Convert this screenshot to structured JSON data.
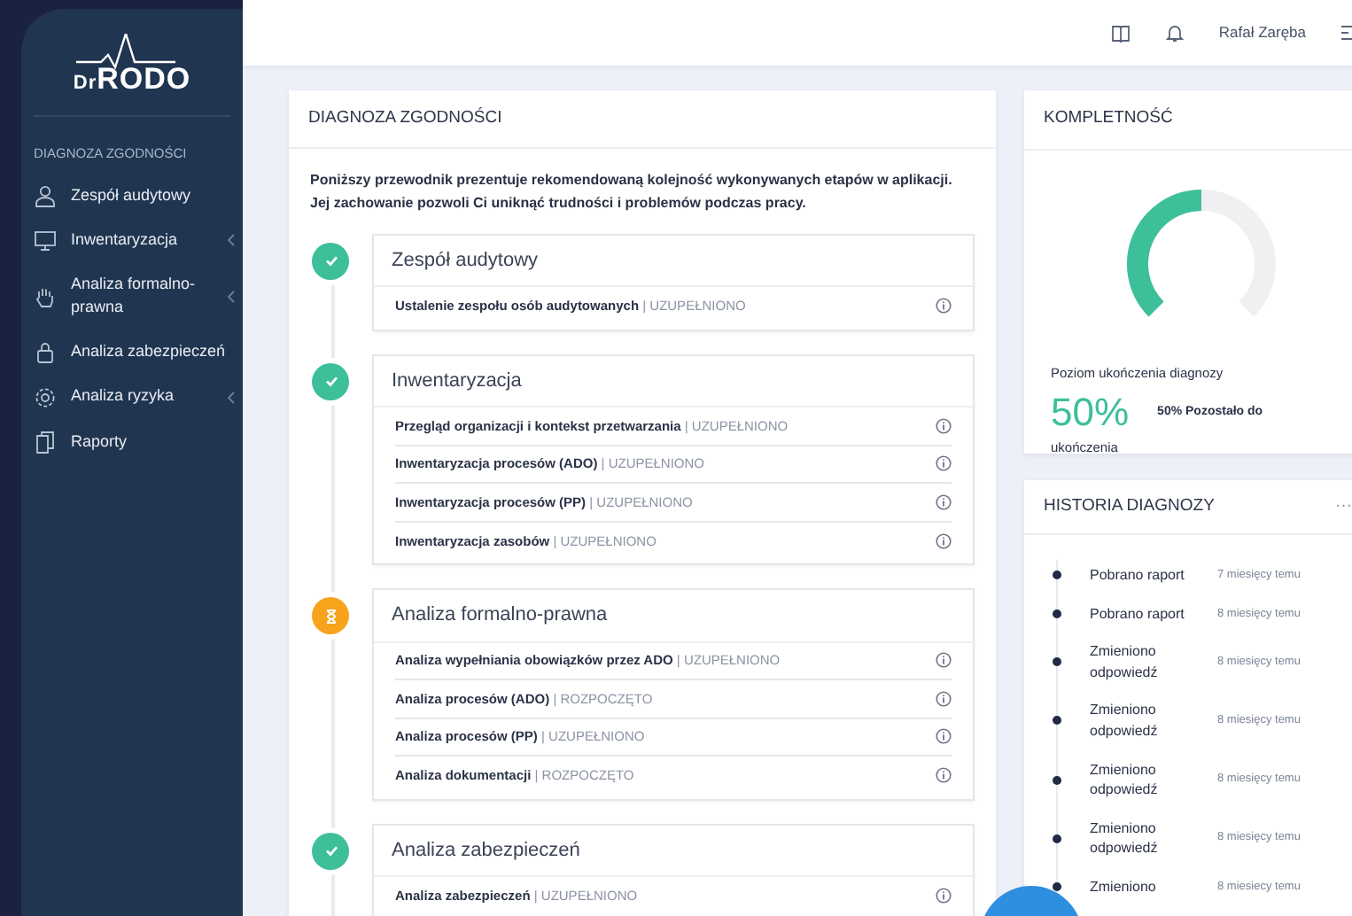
{
  "sidebar": {
    "logo": {
      "prefix": "Dr",
      "name": "RODO"
    },
    "section": "DIAGNOZA ZGODNOŚCI",
    "items": [
      {
        "label": "Zespół audytowy",
        "submenu": false
      },
      {
        "label": "Inwentaryzacja",
        "submenu": true
      },
      {
        "label": "Analiza formalno-prawna",
        "submenu": true
      },
      {
        "label": "Analiza zabezpieczeń",
        "submenu": false
      },
      {
        "label": "Analiza ryzyka",
        "submenu": true
      },
      {
        "label": "Raporty",
        "submenu": false
      }
    ]
  },
  "topbar": {
    "user": "Rafał Zaręba"
  },
  "diagnosis": {
    "title": "DIAGNOZA ZGODNOŚCI",
    "intro": "Poniższy przewodnik prezentuje rekomendowaną kolejność wykonywanych etapów w aplikacji. Jej zachowanie pozwoli Ci uniknąć trudności i problemów podczas pracy.",
    "stages": [
      {
        "title": "Zespół audytowy",
        "kind": "done",
        "steps": [
          "**Ustalenie zespołu osób audytowanych** | UZUPEŁNIONO"
        ]
      },
      {
        "title": "Inwentaryzacja",
        "kind": "done",
        "steps": [
          "**Przegląd organizacji i kontekst przetwarzania** | UZUPEŁNIONO",
          "**Inwentaryzacja procesów (ADO)** | UZUPEŁNIONO",
          "**Inwentaryzacja procesów (PP)** | UZUPEŁNIONO",
          "**Inwentaryzacja zasobów** | UZUPEŁNIONO"
        ]
      },
      {
        "title": "Analiza formalno-prawna",
        "kind": "in_progress",
        "steps": [
          "**Analiza wypełniania obowiązków przez ADO** | UZUPEŁNIONO",
          "**Analiza procesów (ADO)** | ROZPOCZĘTO",
          "**Analiza procesów (PP)** | UZUPEŁNIONO",
          "**Analiza dokumentacji** | ROZPOCZĘTO"
        ]
      },
      {
        "title": "Analiza zabezpieczeń",
        "kind": "done",
        "steps": [
          "**Analiza zabezpieczeń** | UZUPEŁNIONO"
        ]
      }
    ]
  },
  "completeness": {
    "title": "KOMPLETNOŚĆ",
    "level": 0.5,
    "caption": "Poziom ukończenia diagnozy",
    "percent": "50%",
    "remaining": "50% Pozostało do",
    "remaining_end": "ukończenia"
  },
  "history": {
    "title": "HISTORIA DIAGNOZY",
    "menu": "···",
    "items": [
      {
        "text": "Pobrano raport",
        "time": "7 miesięcy temu"
      },
      {
        "text": "Pobrano raport",
        "time": "8 miesięcy temu"
      },
      {
        "text": "Zmieniono odpowiedź",
        "time": "8 miesięcy temu"
      },
      {
        "text": "Zmieniono odpowiedź",
        "time": "8 miesięcy temu"
      },
      {
        "text": "Zmieniono odpowiedź",
        "time": "8 miesięcy temu"
      },
      {
        "text": "Zmieniono odpowiedź",
        "time": "8 miesięcy temu"
      },
      {
        "text": "Zmieniono",
        "time": "8 miesiecy temu"
      }
    ]
  }
}
